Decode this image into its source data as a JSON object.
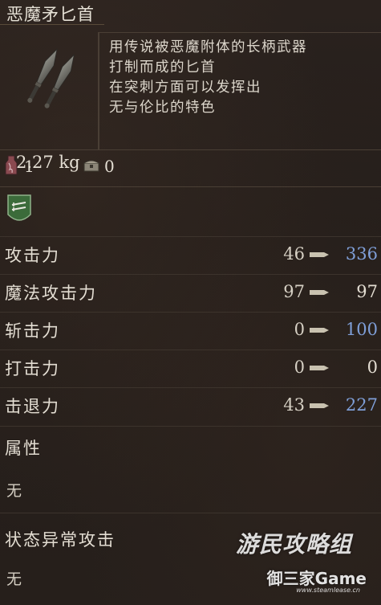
{
  "item": {
    "name": "恶魔矛匕首",
    "weight": "2.27 kg",
    "description": [
      "用传说被恶魔附体的长柄武器",
      "打制而成的匕首",
      "在突刺方面可以发挥出",
      "无与伦比的特色"
    ],
    "icon": "dual-spear-daggers-icon"
  },
  "counts": {
    "owned_value": "1",
    "storage_value": "0",
    "owned_icon": "flask-icon",
    "storage_icon": "chest-icon"
  },
  "attribute_badge": {
    "icon": "dagger-weapon-type-badge-icon",
    "color": "#3b6b3a"
  },
  "stats": [
    {
      "label": "攻击力",
      "base": "46",
      "new": "336",
      "new_color": "blue"
    },
    {
      "label": "魔法攻击力",
      "base": "97",
      "new": "97",
      "new_color": "white"
    },
    {
      "label": "斩击力",
      "base": "0",
      "new": "100",
      "new_color": "blue"
    },
    {
      "label": "打击力",
      "base": "0",
      "new": "0",
      "new_color": "white"
    },
    {
      "label": "击退力",
      "base": "43",
      "new": "227",
      "new_color": "blue"
    }
  ],
  "element": {
    "label": "属性",
    "value": "无"
  },
  "status_attack": {
    "label": "状态异常攻击",
    "value": "无"
  },
  "watermark": {
    "line1": "游民攻略组",
    "line2": "御三家Game",
    "line3": "www.steamlease.cn"
  },
  "colors": {
    "improved_value": "#7f9fd8",
    "text": "#e3ddd2",
    "badge_green": "#3b6b3a"
  }
}
